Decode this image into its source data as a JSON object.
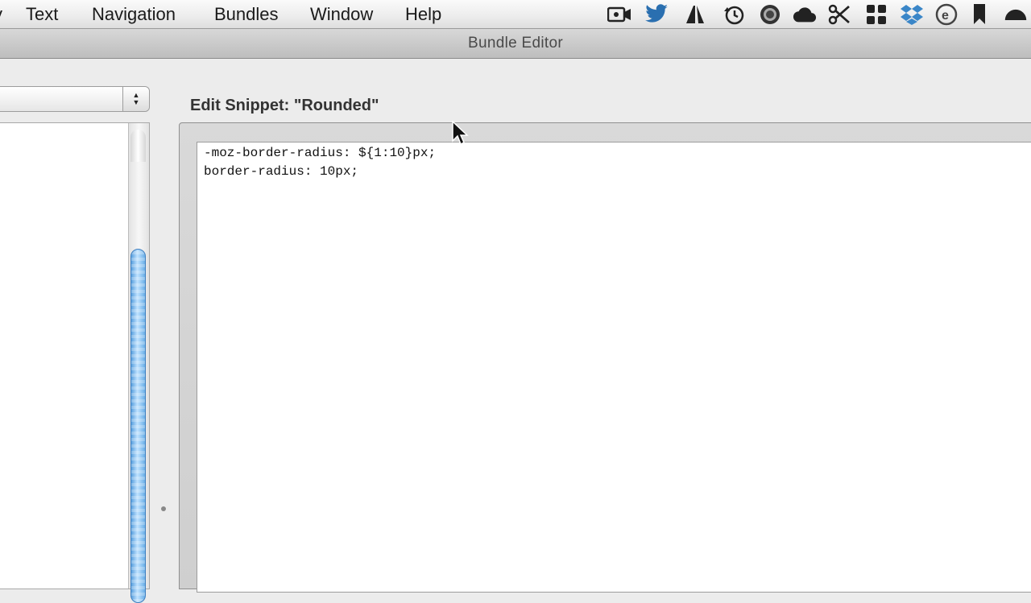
{
  "menubar": {
    "items": [
      {
        "label": "Text"
      },
      {
        "label": "Navigation"
      },
      {
        "label": "Bundles"
      },
      {
        "label": "Window"
      },
      {
        "label": "Help"
      }
    ]
  },
  "window": {
    "title": "Bundle Editor"
  },
  "bundle_popup": {
    "selected": ""
  },
  "editor": {
    "heading": "Edit Snippet: \"Rounded\"",
    "lines": [
      "-moz-border-radius: ${1:10}px;",
      "border-radius: 10px;"
    ]
  },
  "status_icons": [
    "video-camera-icon",
    "twitter-icon",
    "adobe-icon",
    "time-machine-icon",
    "target-icon",
    "cloud-icon",
    "scissors-icon",
    "grid-icon",
    "dropbox-icon",
    "e-icon",
    "bookmark-icon",
    "user-icon"
  ]
}
